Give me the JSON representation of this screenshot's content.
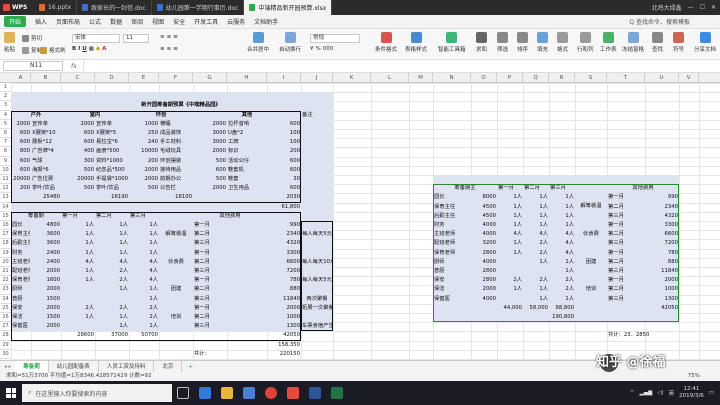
{
  "titlebar": {
    "app": "WPS",
    "tabs": [
      {
        "label": "16.pptx",
        "color": "#e06a2e"
      },
      {
        "label": "致家长的一封信.doc",
        "color": "#3c6fd1"
      },
      {
        "label": "幼儿园第一学期行事历.doc",
        "color": "#3c6fd1"
      },
      {
        "label": "中端精品新开园预算.xlsx",
        "color": "#2eaa4c"
      }
    ],
    "right": "北鸡大绿鑫"
  },
  "menu": {
    "items": [
      "开始",
      "插入",
      "页面布局",
      "公式",
      "数据",
      "审阅",
      "视图",
      "安全",
      "开发工具",
      "云服务",
      "文档助手"
    ],
    "search": "Q 查找命令、搜索模板"
  },
  "ribbon": {
    "paste": "粘贴",
    "cut": "剪切",
    "copy": "复制",
    "format_painter": "格式刷",
    "font": "宋体",
    "size": "11",
    "merge": "合并居中",
    "wrap": "自动换行",
    "number_format": "常规",
    "cond_format": "条件格式",
    "table_style": "表格样式",
    "sum": "求和",
    "filter": "筛选",
    "sort": "排序",
    "fill": "填充",
    "format": "格式",
    "row_col": "行和列",
    "sheet": "工作表",
    "freeze": "冻结窗格",
    "find": "查找",
    "symbol": "符号",
    "share": "分享文档",
    "smart_tools": "智能工具箱"
  },
  "formula_bar": {
    "name_box": "N11",
    "fx": "fx"
  },
  "columns": [
    "A",
    "B",
    "C",
    "D",
    "E",
    "F",
    "G",
    "H",
    "I",
    "J",
    "K",
    "L",
    "M",
    "N",
    "O",
    "P",
    "Q",
    "R",
    "S",
    "T",
    "U",
    "V"
  ],
  "sheet": {
    "title": "新开园筹备期预算《中端精品园》",
    "h_huwai": "户外",
    "h_shinei": "室内",
    "h_huanchuang": "环创",
    "h_qiju": "其他",
    "h_beizhu": "备注",
    "rows_top": [
      [
        "2000",
        "宣传单",
        "2000",
        "宣传单",
        "1000",
        "横幅",
        "2000",
        "拉杆音响",
        "600"
      ],
      [
        "600",
        "X展架*10",
        "600",
        "X展架*5",
        "250",
        "成品装饰",
        "3000",
        "U盘*2",
        "100"
      ],
      [
        "600",
        "展板*12",
        "600",
        "易拉宝*6",
        "240",
        "手工材料",
        "3000",
        "工牌",
        "100"
      ],
      [
        "800",
        "广告牌*4",
        "400",
        "画册*500",
        "10000",
        "毛绒玩具",
        "2000",
        "标识",
        "200"
      ],
      [
        "600",
        "气球",
        "300",
        "资料*1000",
        "200",
        "环创摆装",
        "500",
        "活动公仔",
        "600"
      ],
      [
        "600",
        "海报*6",
        "500",
        "纪念品*500",
        "2000",
        "接待用品",
        "600",
        "鞋套机",
        "600"
      ],
      [
        "20000",
        "广告位费",
        "20000",
        "手提袋*1000",
        "2000",
        "前期办公",
        "500",
        "鞋套",
        "30"
      ],
      [
        "200",
        "茶叶/饮品",
        "500",
        "茶叶/饮品",
        "500",
        "公告栏",
        "2000",
        "卫生用品",
        "600"
      ]
    ],
    "sum_top": [
      "25480",
      "16190",
      "18100",
      "2030"
    ],
    "total_top": "61,800",
    "plan_hdr": [
      "筹备期",
      "第一月",
      "第二月",
      "第三月",
      "其他费用"
    ],
    "plan_rows": [
      [
        "园长",
        "4800",
        "1人",
        "1人",
        "1人",
        "第一月",
        "990"
      ],
      [
        "保育主任",
        "3600",
        "1人",
        "1人",
        "1人",
        "第二月",
        "2340"
      ],
      [
        "后勤主任",
        "3600",
        "1人",
        "1人",
        "1人",
        "第三月",
        "4320"
      ],
      [
        "财务",
        "2400",
        "1人",
        "1人",
        "1人",
        "第一月",
        "3300"
      ],
      [
        "主班老师",
        "2400",
        "4人",
        "4人",
        "4人",
        "第二月",
        "6600"
      ],
      [
        "配班老师",
        "2000",
        "1人",
        "2人",
        "4人",
        "第三月",
        "7200"
      ],
      [
        "保育老师",
        "1600",
        "1人",
        "2人",
        "4人",
        "第一月",
        "780"
      ],
      [
        "厨师",
        "2000",
        "",
        "1人",
        "1人",
        "第二月",
        "880"
      ],
      [
        "普厨",
        "1500",
        "",
        "",
        "1人",
        "第三月",
        "11840"
      ],
      [
        "保安",
        "2000",
        "2人",
        "2人",
        "2人",
        "第一月",
        "2000"
      ],
      [
        "保洁",
        "1500",
        "1人",
        "1人",
        "2人",
        "第二月",
        "1000"
      ],
      [
        "保健医",
        "2000",
        "",
        "1人",
        "1人",
        "第三月",
        "1300"
      ]
    ],
    "plan_side": [
      "解筹装温",
      "伙食费",
      "团建",
      "培训"
    ],
    "plan_sum": [
      "28600",
      "37000",
      "50700",
      "42050"
    ],
    "plan_total1": "158,350",
    "plan_total_label": "共计：",
    "plan_total2": "220150",
    "notes": [
      "每人每天5元",
      "每人每天10元",
      "每人每天5元",
      "两次聚餐",
      "拓展一次聚餐",
      "车票食宿产生费用"
    ],
    "right_hdr": [
      "筹备期主",
      "第一月",
      "第二月",
      "第三月",
      "其他费用"
    ],
    "right_rows": [
      [
        "园长",
        "8000",
        "1人",
        "1人",
        "1人",
        "第一月",
        "990"
      ],
      [
        "保育主任",
        "4500",
        "1人",
        "1人",
        "1人",
        "第二月",
        "2340"
      ],
      [
        "后勤主任",
        "4500",
        "1人",
        "1人",
        "1人",
        "第三月",
        "4320"
      ],
      [
        "财务",
        "4000",
        "1人",
        "1人",
        "1人",
        "第一月",
        "3300"
      ],
      [
        "主班老师",
        "4000",
        "4人",
        "4人",
        "4人",
        "第二月",
        "6600"
      ],
      [
        "配班老师",
        "3200",
        "1人",
        "2人",
        "4人",
        "第三月",
        "7200"
      ],
      [
        "保育老师",
        "2800",
        "1人",
        "2人",
        "4人",
        "第一月",
        "780"
      ],
      [
        "厨师",
        "4000",
        "",
        "1人",
        "1人",
        "第二月",
        "880"
      ],
      [
        "普厨",
        "2800",
        "",
        "",
        "1人",
        "第三月",
        "11840"
      ],
      [
        "保安",
        "2800",
        "2人",
        "2人",
        "2人",
        "第一月",
        "2000"
      ],
      [
        "保洁",
        "2000",
        "1人",
        "1人",
        "2人",
        "第二月",
        "1000"
      ],
      [
        "保健医",
        "4000",
        "",
        "1人",
        "1人",
        "第三月",
        "1300"
      ]
    ],
    "right_side": [
      "解筹装温",
      "伙食费",
      "团建",
      "培训"
    ],
    "right_sum": [
      "44,000",
      "58,000",
      "88,800",
      "42050"
    ],
    "right_total": "190,800",
    "right_total2": "共计：23．2850"
  },
  "status": {
    "sheets": [
      "筹备期",
      "幼儿园配备表",
      "人员工资及待料",
      "北京"
    ],
    "info": "求和=51万3700  平均值=1万8346.428571429  计数=92",
    "zoom": "75%"
  },
  "taskbar": {
    "search": "在这里输入你要搜索的内容",
    "time": "12:41",
    "date": "2019/3/6",
    "ime": "英"
  },
  "watermark": "知乎 @徐福"
}
